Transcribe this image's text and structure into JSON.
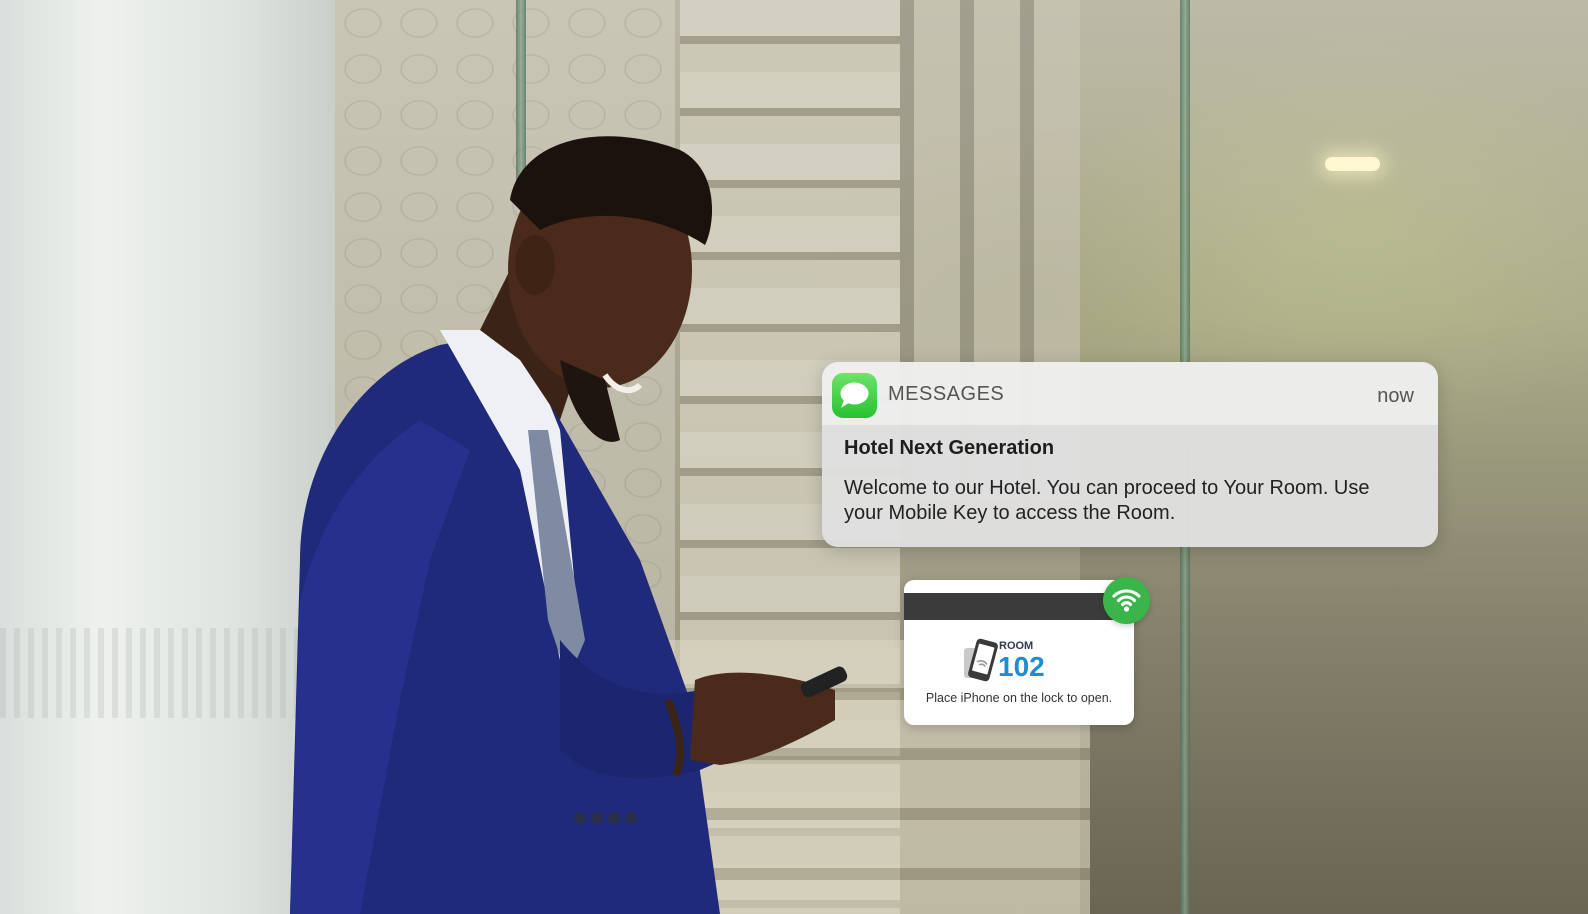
{
  "notification": {
    "app_icon": "messages-icon",
    "app_name": "MESSAGES",
    "time": "now",
    "title": "Hotel Next Generation",
    "message": "Welcome to our Hotel. You can proceed to Your Room. Use your Mobile Key to access the Room."
  },
  "mobile_key": {
    "room_label": "ROOM",
    "room_number": "102",
    "instructions": "Place iPhone on the lock to open.",
    "status_icon": "wifi-icon",
    "phone_icon": "iphone-icon"
  },
  "colors": {
    "messages_green": "#28c12f",
    "room_number_blue": "#1f8dd0",
    "wifi_badge_green": "#39b54a",
    "suit_blue": "#1f2a7a"
  }
}
